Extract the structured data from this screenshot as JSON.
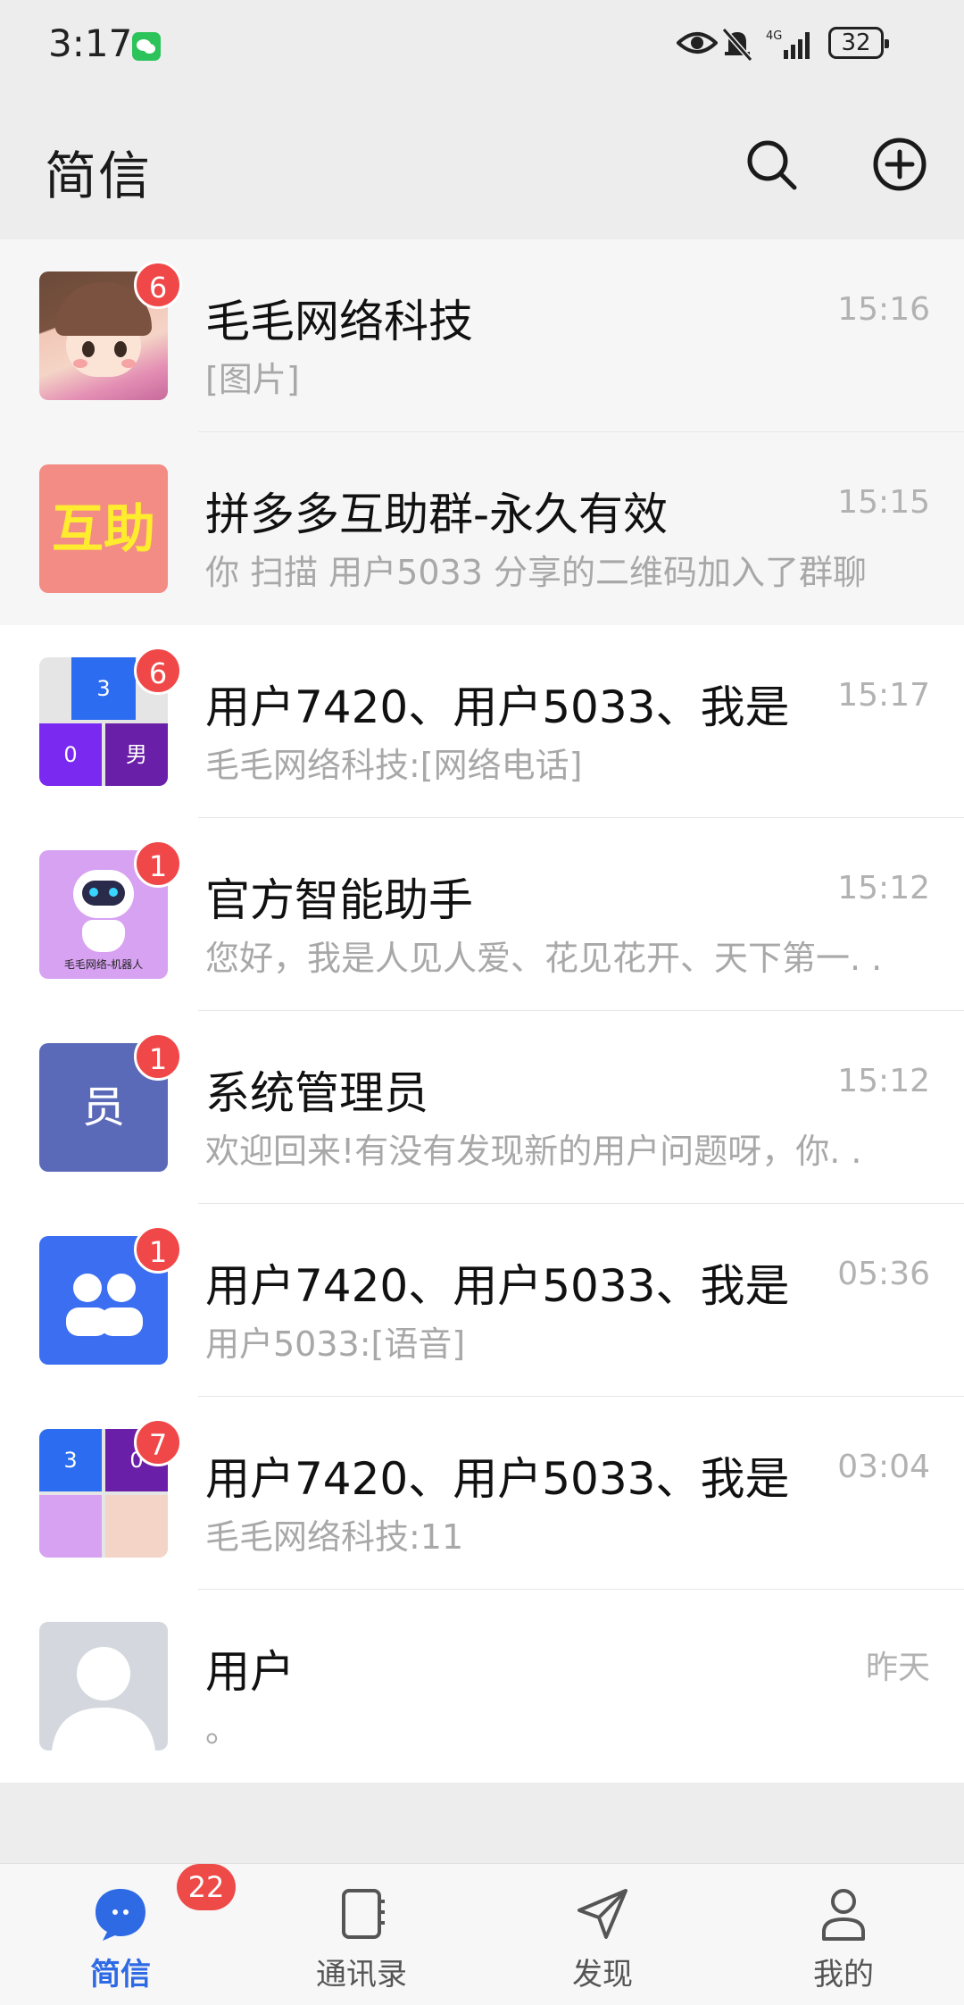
{
  "status_bar": {
    "time": "3:17",
    "network": "4G",
    "battery": "32"
  },
  "header": {
    "title": "简信"
  },
  "chats": [
    {
      "name": "毛毛网络科技",
      "preview": "[图片]",
      "time": "15:16",
      "badge": "6"
    },
    {
      "name": "拼多多互助群-永久有效",
      "preview": "你 扫描 用户5033 分享的二维码加入了群聊",
      "time": "15:15",
      "badge": "",
      "avatar_text": "互助"
    },
    {
      "name": "用户7420、用户5033、我是",
      "preview": "毛毛网络科技:[网络电话]",
      "time": "15:17",
      "badge": "6",
      "avatar_cells": [
        "3",
        "0",
        "男"
      ]
    },
    {
      "name": "官方智能助手",
      "preview": "您好，我是人见人爱、花见花开、天下第一. .",
      "time": "15:12",
      "badge": "1",
      "avatar_caption": "毛毛网络-机器人"
    },
    {
      "name": "系统管理员",
      "preview": "欢迎回来!有没有发现新的用户问题呀，你. .",
      "time": "15:12",
      "badge": "1",
      "avatar_text": "员"
    },
    {
      "name": "用户7420、用户5033、我是",
      "preview": "用户5033:[语音]",
      "time": "05:36",
      "badge": "1"
    },
    {
      "name": "用户7420、用户5033、我是",
      "preview": "毛毛网络科技:11",
      "time": "03:04",
      "badge": "7",
      "avatar_cells": [
        "3",
        "0"
      ]
    },
    {
      "name": "用户",
      "preview": "。",
      "time": "昨天",
      "badge": ""
    }
  ],
  "tabs": [
    {
      "label": "简信",
      "icon": "chat-bubble-icon",
      "badge": "22"
    },
    {
      "label": "通讯录",
      "icon": "contacts-book-icon"
    },
    {
      "label": "发现",
      "icon": "send-arrow-icon"
    },
    {
      "label": "我的",
      "icon": "person-icon"
    }
  ],
  "colors": {
    "accent": "#2f6ae5",
    "badge": "#f04848",
    "background": "#ededed"
  }
}
